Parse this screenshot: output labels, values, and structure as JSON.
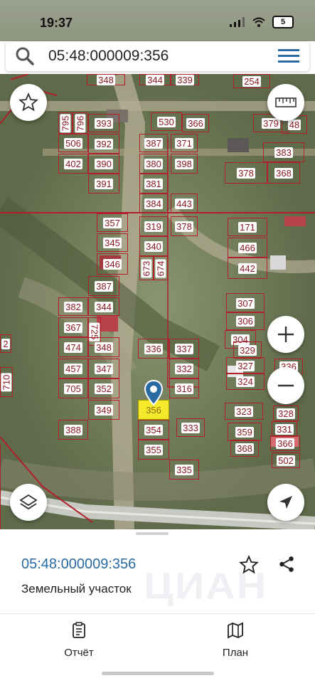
{
  "status": {
    "time": "19:37",
    "battery": "5"
  },
  "search": {
    "value": "05:48:000009:356"
  },
  "map": {
    "parcels": [
      "348",
      "344",
      "339",
      "254",
      "795",
      "796",
      "393",
      "530",
      "366",
      "379",
      "48",
      "506",
      "392",
      "387",
      "371",
      "383",
      "402",
      "390",
      "380",
      "398",
      "378",
      "368",
      "391",
      "381",
      "384",
      "443",
      "357",
      "319",
      "378",
      "171",
      "345",
      "340",
      "466",
      "346",
      "673",
      "674",
      "442",
      "387",
      "382",
      "344",
      "307",
      "367",
      "725",
      "306",
      "474",
      "348",
      "336",
      "337",
      "304",
      "329",
      "457",
      "347",
      "332",
      "327",
      "336",
      "705",
      "352",
      "316",
      "324",
      "349",
      "356",
      "323",
      "328",
      "388",
      "354",
      "333",
      "359",
      "331",
      "355",
      "368",
      "366",
      "335",
      "502",
      "2",
      "710"
    ],
    "selected_parcel": "356"
  },
  "colors": {
    "accent": "#2a6aa3",
    "parcel_border": "#b0202a",
    "selected": "#f5ea2a"
  },
  "sheet": {
    "cadastral_number": "05:48:000009:356",
    "type": "Земельный участок",
    "watermark": "ЦИАН"
  },
  "tabs": [
    {
      "label": "Отчёт",
      "icon": "report-icon"
    },
    {
      "label": "План",
      "icon": "map-plan-icon"
    }
  ]
}
